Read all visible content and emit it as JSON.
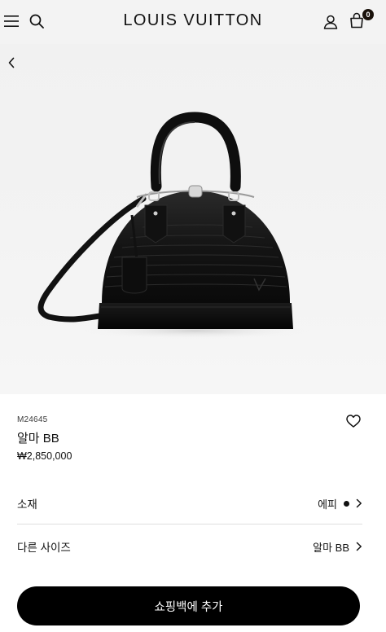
{
  "header": {
    "brand": "LOUIS VUITTON",
    "bag_count": "0",
    "icons": {
      "menu": "hamburger-menu-icon",
      "search": "search-icon",
      "account": "user-icon",
      "bag": "shopping-bag-icon"
    }
  },
  "hero": {
    "back_icon": "chevron-left-icon",
    "image_subject": "black Epi leather Alma BB handbag"
  },
  "product": {
    "sku": "M24645",
    "name": "알마 BB",
    "price": "₩2,850,000",
    "wishlist_icon": "heart-outline-icon"
  },
  "options": [
    {
      "label": "소재",
      "value": "에피",
      "swatch_color": "#111111"
    },
    {
      "label": "다른 사이즈",
      "value": "알마 BB"
    }
  ],
  "cta": {
    "label": "쇼핑백에 추가"
  },
  "colors": {
    "header_bg": "#f3f3f3",
    "text": "#19110b",
    "cta_bg": "#000000",
    "cta_text": "#ffffff"
  }
}
